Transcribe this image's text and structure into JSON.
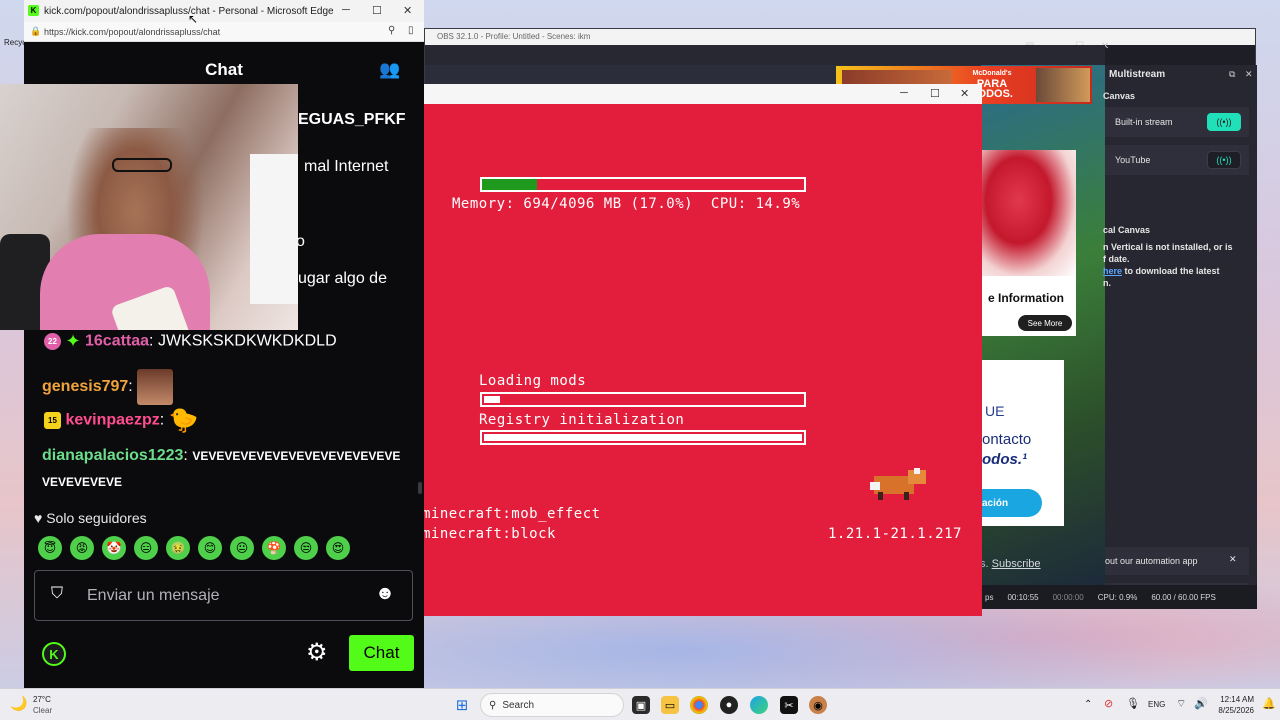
{
  "edge": {
    "title": "kick.com/popout/alondrissapluss/chat - Personal - Microsoft Edge",
    "url": "https://kick.com/popout/alondrissapluss/chat",
    "logo_letter": "K"
  },
  "chat": {
    "header_title": "Chat",
    "partial_lines": [
      "EGUAS_PFKF",
      "mal Internet",
      "o",
      "ugar algo de"
    ],
    "messages": [
      {
        "badge": "22",
        "badge_color": "#e05fa8",
        "user": "16cattaa",
        "user_color": "#e05fa8",
        "text": "JWKSKSKDKWKDKDLD"
      },
      {
        "user": "genesis797",
        "user_color": "#f0a33a",
        "text": ""
      },
      {
        "badge": "15",
        "badge_color": "#f5d21c",
        "user": "kevinpaezpz",
        "user_color": "#ff4d8d",
        "text": ""
      },
      {
        "user": "dianapalacios1223",
        "user_color": "#6ddc8a",
        "text": "VEVEVEVEVEVEVEVEVEVEVEVEVEVEVEVEVEVE"
      }
    ],
    "followers_only": "Solo seguidores",
    "emote_icons": [
      "😇",
      "😡",
      "🤡",
      "😑",
      "🤢",
      "😊",
      "😐",
      "🍄",
      "😒",
      "😍"
    ],
    "input_placeholder": "Enviar un mensaje",
    "send_label": "Chat"
  },
  "minecraft": {
    "memory": "Memory: 694/4096 MB (17.0%)  CPU: 14.9%",
    "memory_fill": 0.17,
    "loading_mods": "Loading mods",
    "loading_fill": 0.05,
    "registry": "Registry initialization",
    "registry_fill": 1.0,
    "line1": "minecraft:mob_effect",
    "line2": "minecraft:block",
    "version": "1.21.1-21.1.217"
  },
  "obs": {
    "title": "OBS 32.1.0 - Profile: Untitled - Scenes: ikm",
    "dock_title": "Multistream",
    "canvas_label": "Canvas",
    "builtin_stream": "Built-in stream",
    "youtube": "YouTube",
    "vertical_canvas_label": "cal Canvas",
    "vertical_msg_1": "n Vertical is not installed, or is",
    "vertical_msg_2": "f date.",
    "vertical_msg_link": "here",
    "vertical_msg_3": " to download the latest",
    "vertical_msg_4": "n.",
    "automation": "out our automation app",
    "status_bps": "ps",
    "status_time": "00:10:55",
    "status_rec": "00:00:00",
    "status_cpu": "CPU: 0.9%",
    "status_fps": "60.00 / 60.00 FPS",
    "accent": "#1fe0b8"
  },
  "ads": {
    "mcd_brand": "McDonald's",
    "mcd_line1": "PARA",
    "mcd_line2": "TODOS.",
    "red_info": "e Information",
    "red_btn": "See More",
    "contact_1": "UE",
    "contact_2": "ontacto",
    "contact_3": "odos.¹",
    "contact_btn": "ación",
    "subscribe_prefix": "s. ",
    "subscribe": "Subscribe"
  },
  "taskbar": {
    "weather_temp": "27°C",
    "weather_desc": "Clear",
    "search": "Search",
    "lang": "ENG",
    "time": "12:14 AM",
    "date": "8/25/2026"
  },
  "desktop": {
    "recycle_label": "Recyc"
  }
}
